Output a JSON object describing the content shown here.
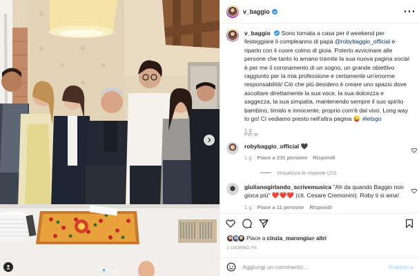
{
  "post": {
    "author": "v_baggio",
    "more_icon": "more-horizontal-icon",
    "photo_alt": "Family celebration photo",
    "carousel": {
      "count": 6,
      "active_index": 1
    }
  },
  "caption": {
    "username": "v_baggio",
    "text_1": "Sono tornata a casa per il weekend per festeggiare il compleanno di papà ",
    "mention": "@robybaggio_official",
    "text_2": " e riparto con il cuore colmo di gioia. Poterlo avvicinare alle persone che tanto lo amano tramite la sua nuova pagina social è per me il coronamento di un sogno, un grande obiettivo raggiunto per la mia professione e certamente un'enorme responsabilità! Ciò che più desidero è creare uno spazio dove ascoltare direttamente la sua voce, la sua dolcezza e saggezza, la sua simpatia, mantenendo sempre il suo spirito bambino, timido e innocente, proprio com'è dal vivo. Long way to go! Ci vediamo presto nell'altra pagina 😜 ",
    "hashtag": "#letsgo",
    "time": "1 g",
    "translate": "Per te"
  },
  "comments": [
    {
      "username": "robybaggio_official",
      "text": " 🖤",
      "time": "1 g",
      "likes": "Piace a 231 persone",
      "reply": "Rispondi",
      "view_replies": "Visualizza le risposte (20)"
    },
    {
      "username": "giulianogirlando_scrivemusica",
      "text": " \"Ah da quando Baggio non gioca più\" ❤️❤️❤️ (cit. Cesare Cremonini). Roby ti si ama!",
      "time": "1 g",
      "likes": "Piace a 11 persone",
      "reply": "Rispondi"
    }
  ],
  "likes": {
    "prefix": "Piace a ",
    "user": "cinzia_marongiu",
    "middle": " e ",
    "others": "altri"
  },
  "posted_ago": "1 GIORNO FA",
  "comment_box": {
    "placeholder": "Aggiungi un commento...",
    "publish": "Pubblica"
  },
  "colors": {
    "verified": "#3897f0",
    "link": "#00376b",
    "muted": "#8e8e8e",
    "publish_disabled": "#b3dbff",
    "carousel_active": "#3a9bf1"
  }
}
